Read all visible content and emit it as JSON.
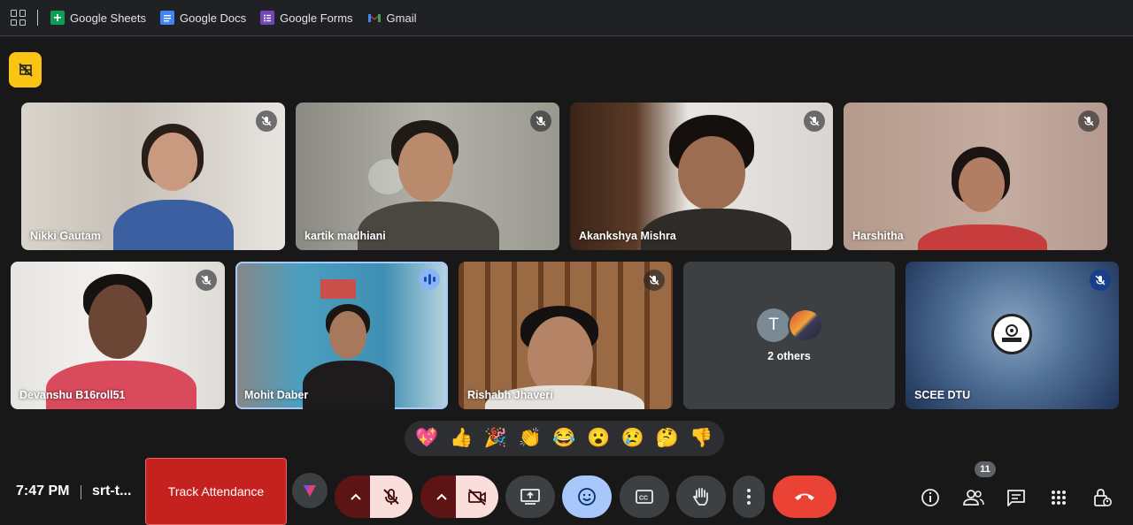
{
  "bookmarks": [
    {
      "label": "Google Sheets",
      "icon": "google-sheets-icon",
      "color": "#0f9d58"
    },
    {
      "label": "Google Docs",
      "icon": "google-docs-icon",
      "color": "#4285f4"
    },
    {
      "label": "Google Forms",
      "icon": "google-forms-icon",
      "color": "#7248b9"
    },
    {
      "label": "Gmail",
      "icon": "gmail-icon",
      "color": "#ea4335"
    }
  ],
  "participants": [
    {
      "name": "Nikki Gautam",
      "mic": "off"
    },
    {
      "name": "kartik madhiani",
      "mic": "off"
    },
    {
      "name": "Akankshya Mishra",
      "mic": "off"
    },
    {
      "name": "Harshitha",
      "mic": "off"
    },
    {
      "name": "Devanshu B16roll51",
      "mic": "off"
    },
    {
      "name": "Mohit Daber",
      "mic": "speaking"
    },
    {
      "name": "Rishabh Jhaveri",
      "mic": "off"
    },
    {
      "name": "SCEE DTU",
      "mic": "off"
    }
  ],
  "others": {
    "label": "2 others",
    "avatar_letter": "T"
  },
  "reactions": [
    "💖",
    "👍",
    "🎉",
    "👏",
    "😂",
    "😮",
    "😢",
    "🤔",
    "👎"
  ],
  "controls": {
    "time": "7:47 PM",
    "meeting_code": "srt-t...",
    "attendance_label": "Track Attendance",
    "people_count": "11"
  },
  "colors": {
    "background": "#181818",
    "hangup": "#ea4335",
    "accent": "#8ab4f8",
    "pin": "#f9c512"
  }
}
